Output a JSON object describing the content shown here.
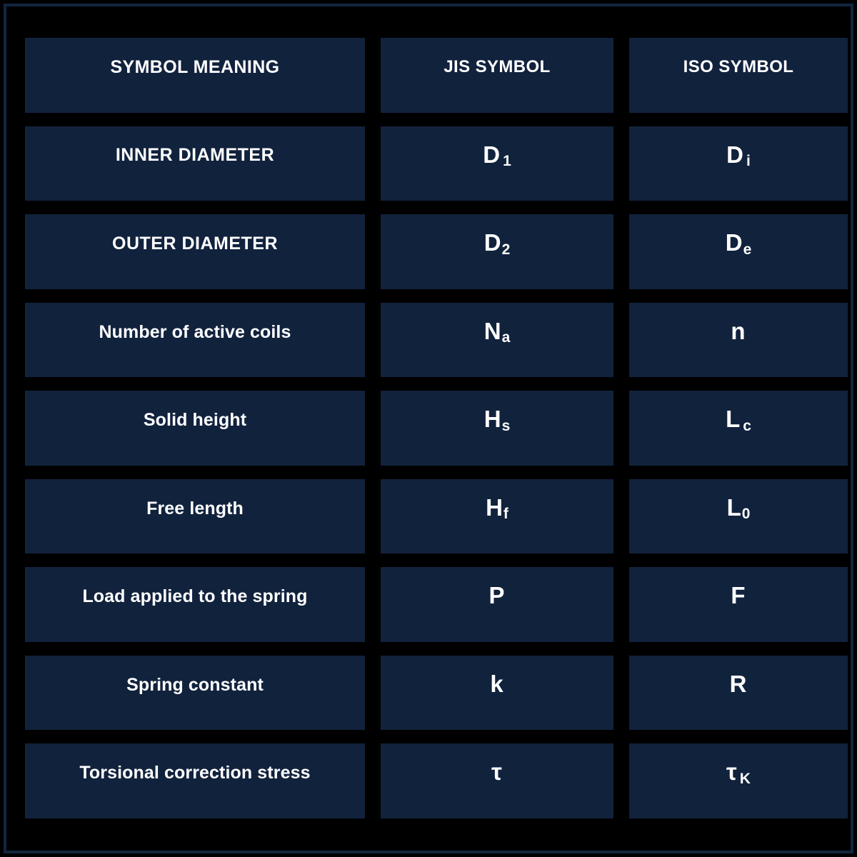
{
  "table": {
    "columns": [
      {
        "label": "SYMBOL MEANING"
      },
      {
        "label": "JIS SYMBOL"
      },
      {
        "label": "ISO SYMBOL"
      }
    ],
    "rows": [
      {
        "meaning": "INNER DIAMETER",
        "jis_base": "D",
        "jis_sub": "1",
        "iso_base": "D",
        "iso_sub": "i"
      },
      {
        "meaning": "OUTER DIAMETER",
        "jis_base": "D",
        "jis_sub": "2",
        "iso_base": "D",
        "iso_sub": "e"
      },
      {
        "meaning": "Number of active coils",
        "jis_base": "N",
        "jis_sub": "a",
        "iso_base": "n",
        "iso_sub": ""
      },
      {
        "meaning": "Solid height",
        "jis_base": "H",
        "jis_sub": "s",
        "iso_base": "L",
        "iso_sub": "c"
      },
      {
        "meaning": "Free length",
        "jis_base": "H",
        "jis_sub": "f",
        "iso_base": "L",
        "iso_sub": "0"
      },
      {
        "meaning": "Load applied to the spring",
        "jis_base": "P",
        "jis_sub": "",
        "iso_base": "F",
        "iso_sub": ""
      },
      {
        "meaning": "Spring constant",
        "jis_base": "k",
        "jis_sub": "",
        "iso_base": "R",
        "iso_sub": ""
      },
      {
        "meaning": "Torsional correction stress",
        "jis_base": "τ",
        "jis_sub": "",
        "iso_base": "τ",
        "iso_sub": "K"
      }
    ]
  },
  "colors": {
    "cell_background": "#11223d",
    "page_background": "#000000",
    "text": "#ffffff",
    "frame_border": "#11253f"
  }
}
